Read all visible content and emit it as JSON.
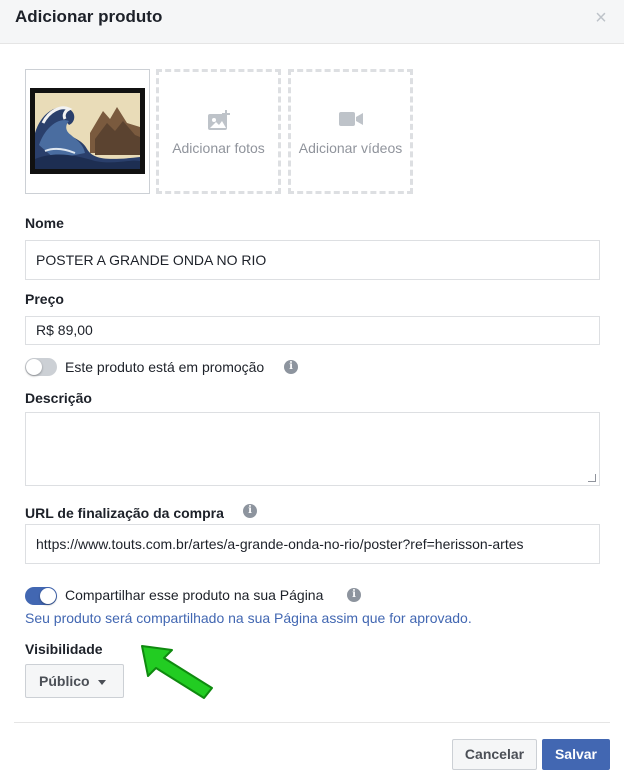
{
  "dialog": {
    "title": "Adicionar produto",
    "close_symbol": "×"
  },
  "media": {
    "photo_alt": "A grande onda",
    "add_photos_label": "Adicionar fotos",
    "add_photos_icon": "add-photo-icon",
    "add_videos_label": "Adicionar vídeos",
    "add_videos_icon": "video-camera-icon"
  },
  "name": {
    "label": "Nome",
    "value": "POSTER A GRANDE ONDA NO RIO"
  },
  "price": {
    "label": "Preço",
    "value": "R$ 89,00"
  },
  "promo": {
    "label": "Este produto está em promoção",
    "enabled": false
  },
  "description": {
    "label": "Descrição",
    "value": ""
  },
  "checkout_url": {
    "label": "URL de finalização da compra",
    "value": "https://www.touts.com.br/artes/a-grande-onda-no-rio/poster?ref=herisson-artes"
  },
  "share": {
    "label": "Compartilhar esse produto na sua Página",
    "enabled": true,
    "note": "Seu produto será compartilhado na sua Página assim que for aprovado."
  },
  "visibility": {
    "label": "Visibilidade",
    "selected": "Público"
  },
  "footer": {
    "cancel_label": "Cancelar",
    "save_label": "Salvar"
  },
  "colors": {
    "accent": "#4267b2",
    "annotation_arrow": "#22cc22"
  }
}
